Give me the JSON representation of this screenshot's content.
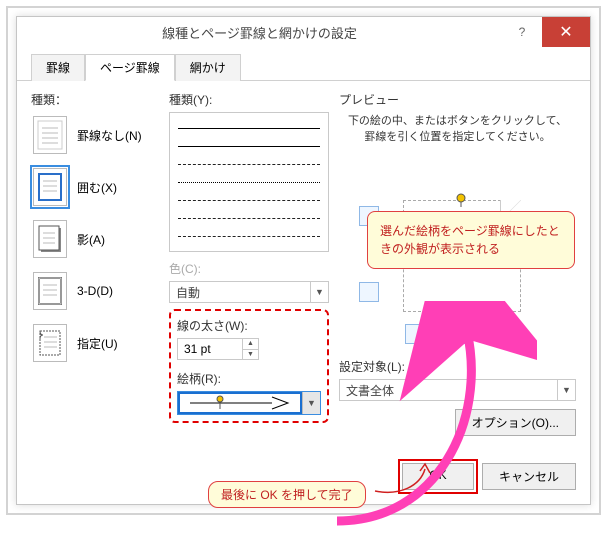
{
  "title": "線種とページ罫線と網かけの設定",
  "tabs": {
    "t0": "罫線",
    "t1": "ページ罫線",
    "t2": "網かけ"
  },
  "left": {
    "label": "種類：",
    "items": {
      "none": "罫線なし(N)",
      "box": "囲む(X)",
      "shadow": "影(A)",
      "threed": "3-D(D)",
      "custom": "指定(U)"
    }
  },
  "mid": {
    "style_label": "種類(Y):",
    "color_label": "色(C):",
    "color_value": "自動",
    "width_label": "線の太さ(W):",
    "width_value": "31 pt",
    "pattern_label": "絵柄(R):"
  },
  "right": {
    "label": "プレビュー",
    "hint": "下の絵の中、またはボタンをクリックして、罫線を引く位置を指定してください。",
    "applyto_label": "設定対象(L):",
    "applyto_value": "文書全体",
    "options": "オプション(O)..."
  },
  "callout": "選んだ絵柄をページ罫線にしたときの外観が表示される",
  "bottom_callout": "最後に OK を押して完了",
  "buttons": {
    "ok": "OK",
    "cancel": "キャンセル"
  }
}
